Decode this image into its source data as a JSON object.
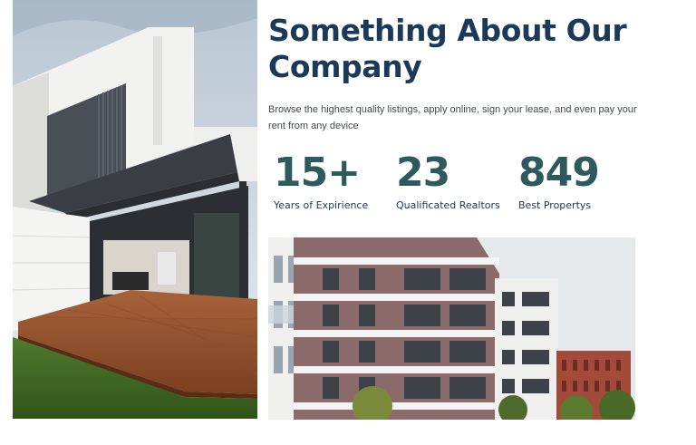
{
  "about": {
    "heading_line1": "Something About Our",
    "heading_line2": "Company",
    "description": "Browse the highest quality listings, apply online, sign your lease, and even pay your rent from any device"
  },
  "stats": [
    {
      "value": "15+",
      "label": "Years of Expirience"
    },
    {
      "value": "23",
      "label": "Qualificated Realtors"
    },
    {
      "value": "849",
      "label": "Best Propertys"
    }
  ],
  "colors": {
    "heading": "#1b3a5a",
    "stat_value": "#2e5a5e",
    "body_text": "#444a50"
  }
}
